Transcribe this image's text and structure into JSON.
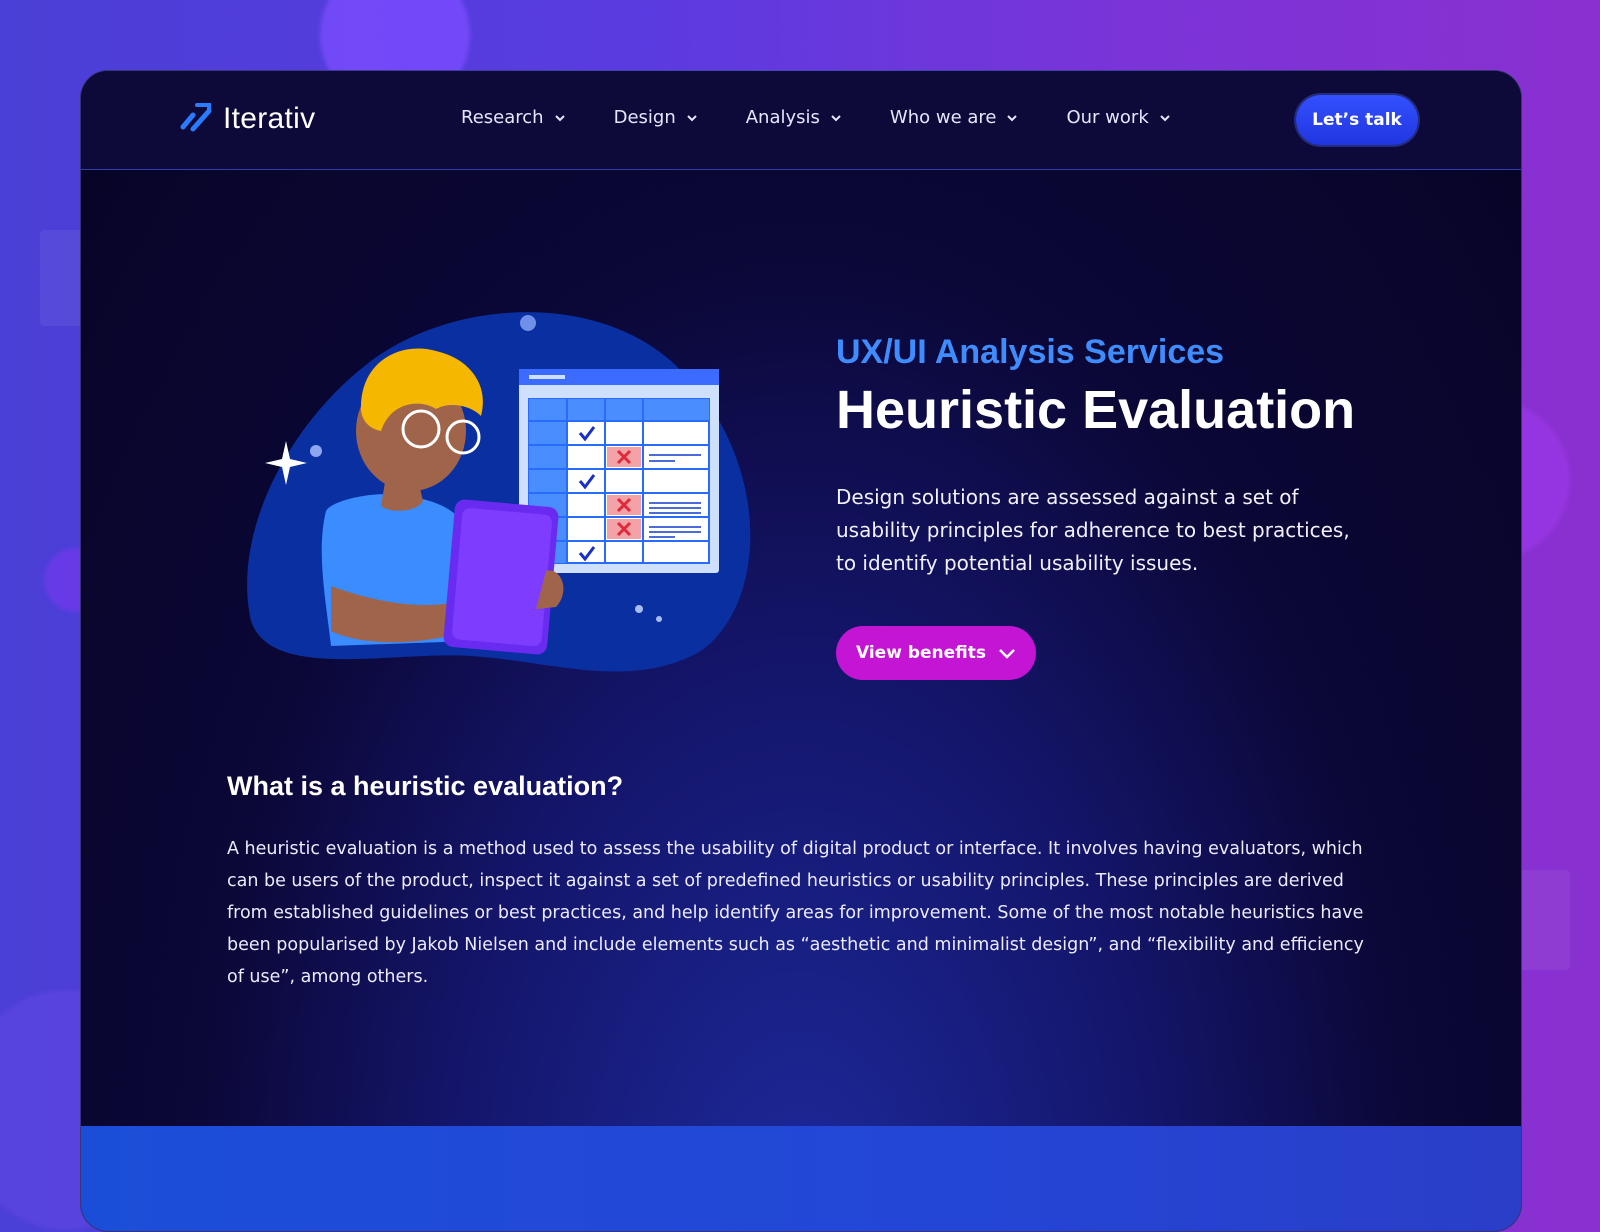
{
  "brand": {
    "name": "Iterativ"
  },
  "nav": {
    "items": [
      {
        "label": "Research"
      },
      {
        "label": "Design"
      },
      {
        "label": "Analysis"
      },
      {
        "label": "Who we are"
      },
      {
        "label": "Our work"
      }
    ],
    "cta_label": "Let’s talk"
  },
  "hero": {
    "eyebrow": "UX/UI Analysis Services",
    "title": "Heuristic Evaluation",
    "description": "Design solutions are assessed against a set of usability principles for adherence to best practices, to identify potential usability issues.",
    "button_label": "View benefits"
  },
  "section": {
    "heading": "What is a heuristic evaluation?",
    "body": "A heuristic evaluation is a method used to assess the usability of digital product or interface. It involves having evaluators, which can be users of the product, inspect it against a set of predefined heuristics or usability principles. These principles are derived from established guidelines or best practices, and help identify areas for improvement. Some of the most notable heuristics have been popularised by Jakob Nielsen and include elements such as “aesthetic and minimalist design”, and “flexibility and efficiency of use”, among others."
  },
  "colors": {
    "accent_blue": "#3f8cff",
    "cta_blue": "#2f49ff",
    "magenta": "#c414d4",
    "navy": "#0b0736"
  },
  "icons": [
    "logo-icon",
    "chevron-down-icon",
    "sparkle-icon",
    "check-icon",
    "cross-icon"
  ]
}
